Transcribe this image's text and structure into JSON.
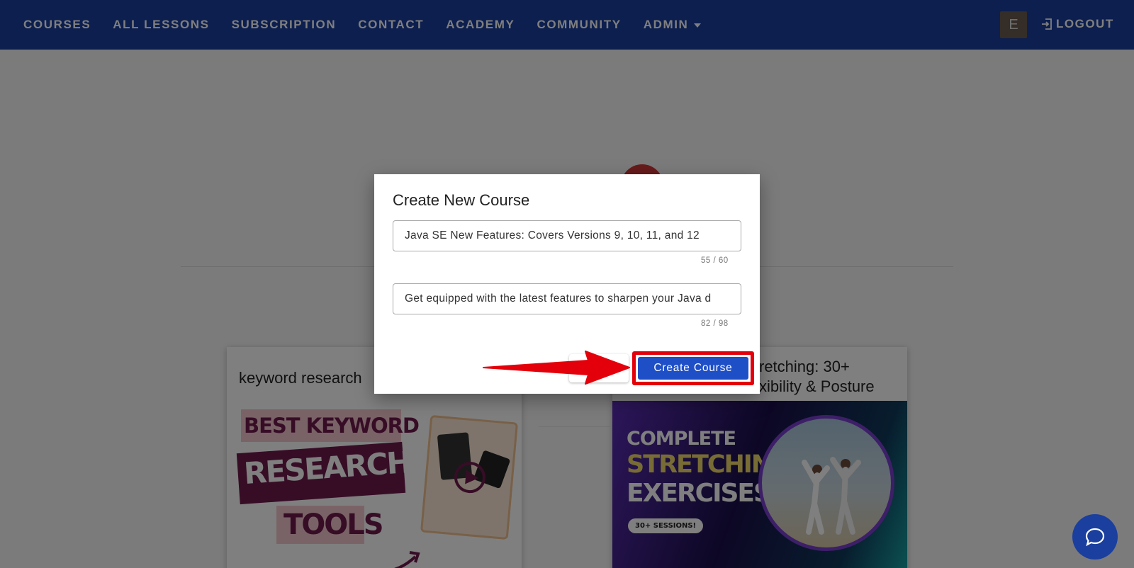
{
  "nav": {
    "items": [
      "COURSES",
      "ALL LESSONS",
      "SUBSCRIPTION",
      "CONTACT",
      "ACADEMY",
      "COMMUNITY",
      "ADMIN"
    ],
    "avatar_initial": "E",
    "logout_label": "LOGOUT",
    "background": "#1a3f9e"
  },
  "cards": [
    {
      "title": "keyword research",
      "thumb_lines": [
        "BEST KEYWORD",
        "RESEARCH",
        "TOOLS"
      ]
    },
    {
      "title_line1": "retching: 30+",
      "title_line2": "xibility & Posture",
      "thumb_lines": [
        "COMPLETE",
        "STRETCHING",
        "EXERCISES"
      ],
      "thumb_pill": "30+ SESSIONS!"
    }
  ],
  "dialog": {
    "title": "Create New Course",
    "title_field_value": "Java SE New Features: Covers Versions 9, 10, 11, and 12",
    "title_counter": "55 / 60",
    "desc_field_value": "Get equipped with the latest features to sharpen your Java d",
    "desc_counter": "82 / 98",
    "create_label": "Create Course",
    "highlight_color": "#e3000b"
  },
  "icons": {
    "logout": "logout-icon",
    "chat": "chat-icon",
    "caret": "chevron-down-icon",
    "arrow": "annotation-arrow-icon"
  }
}
